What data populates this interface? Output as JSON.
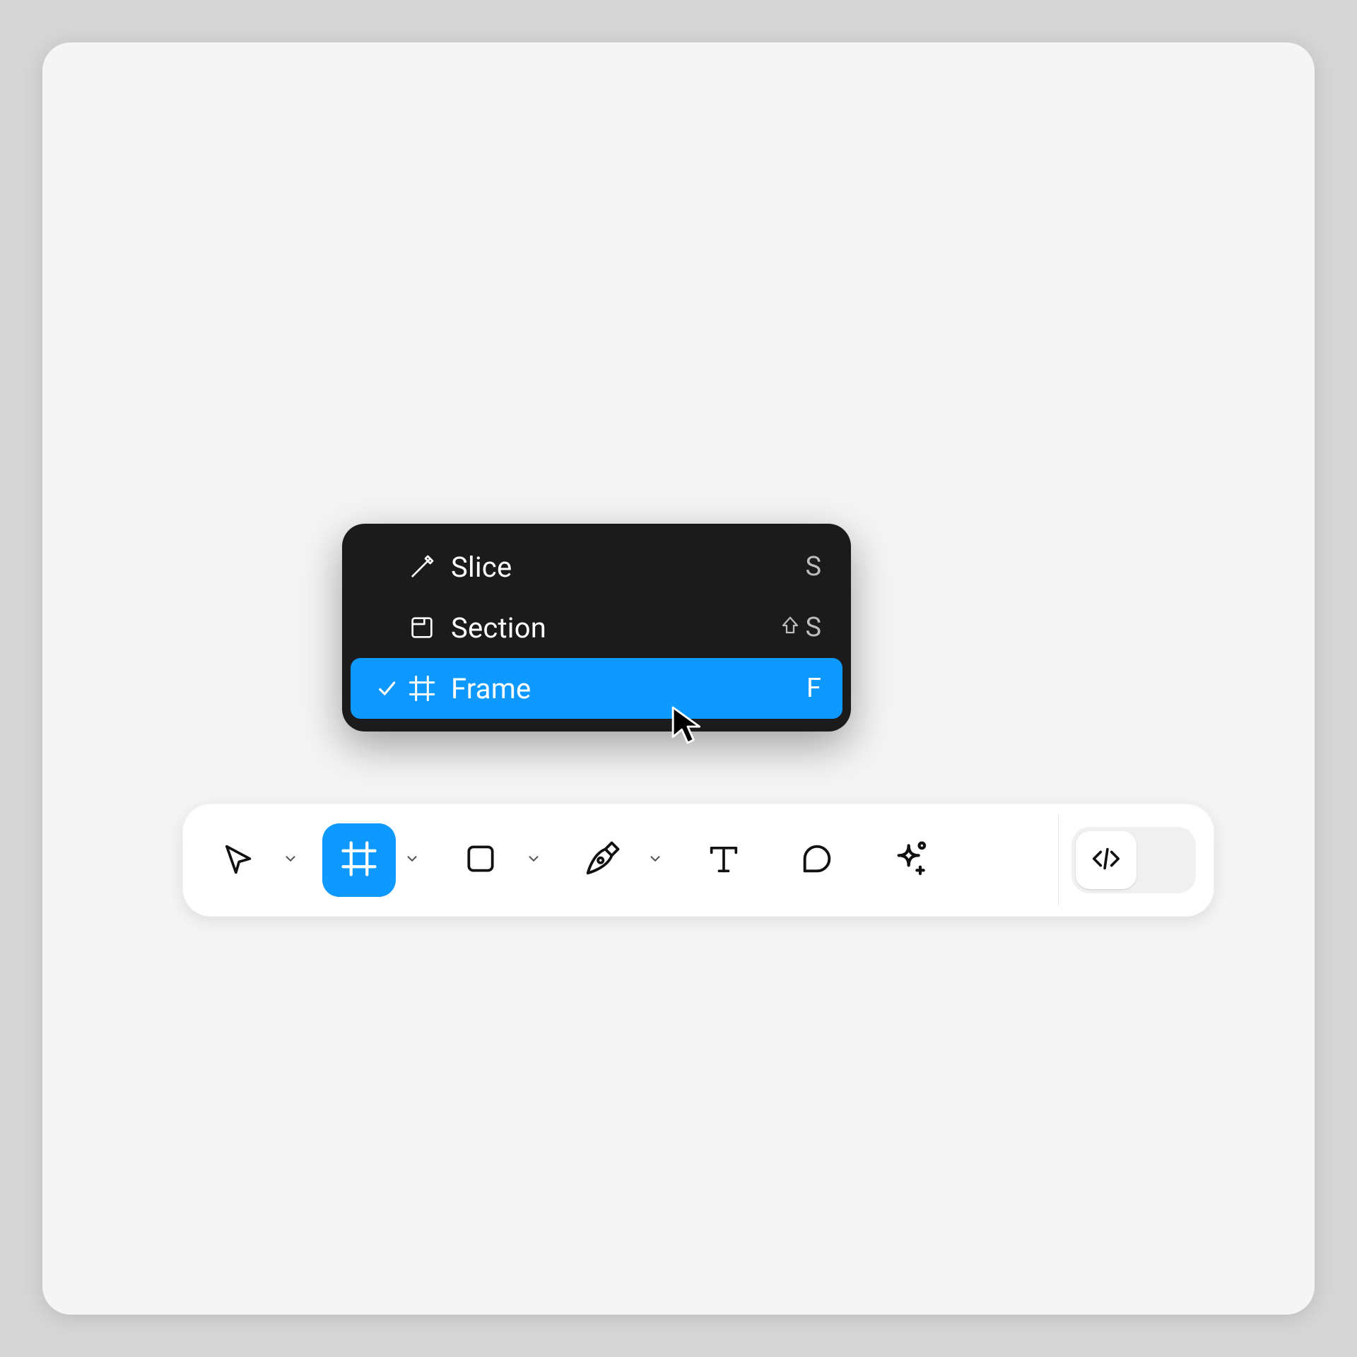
{
  "menu": {
    "items": [
      {
        "icon": "slice-icon",
        "label": "Slice",
        "shortcut": "S",
        "shift": false,
        "selected": false
      },
      {
        "icon": "section-icon",
        "label": "Section",
        "shortcut": "S",
        "shift": true,
        "selected": false
      },
      {
        "icon": "frame-icon",
        "label": "Frame",
        "shortcut": "F",
        "shift": false,
        "selected": true
      }
    ]
  },
  "toolbar": {
    "tools": [
      {
        "name": "move-tool",
        "icon": "cursor-icon",
        "chevron": true,
        "active": false
      },
      {
        "name": "frame-tool",
        "icon": "frame-icon",
        "chevron": true,
        "active": true
      },
      {
        "name": "shape-tool",
        "icon": "square-icon",
        "chevron": true,
        "active": false
      },
      {
        "name": "pen-tool",
        "icon": "pen-icon",
        "chevron": true,
        "active": false
      },
      {
        "name": "text-tool",
        "icon": "text-icon",
        "chevron": false,
        "active": false
      },
      {
        "name": "comment-tool",
        "icon": "comment-icon",
        "chevron": false,
        "active": false
      },
      {
        "name": "ai-tool",
        "icon": "sparkle-icon",
        "chevron": false,
        "active": false
      }
    ],
    "dev_mode": {
      "icon": "code-icon"
    }
  },
  "colors": {
    "accent": "#0d99ff",
    "menu_bg": "#1b1b1b",
    "canvas": "#f5f5f5"
  }
}
